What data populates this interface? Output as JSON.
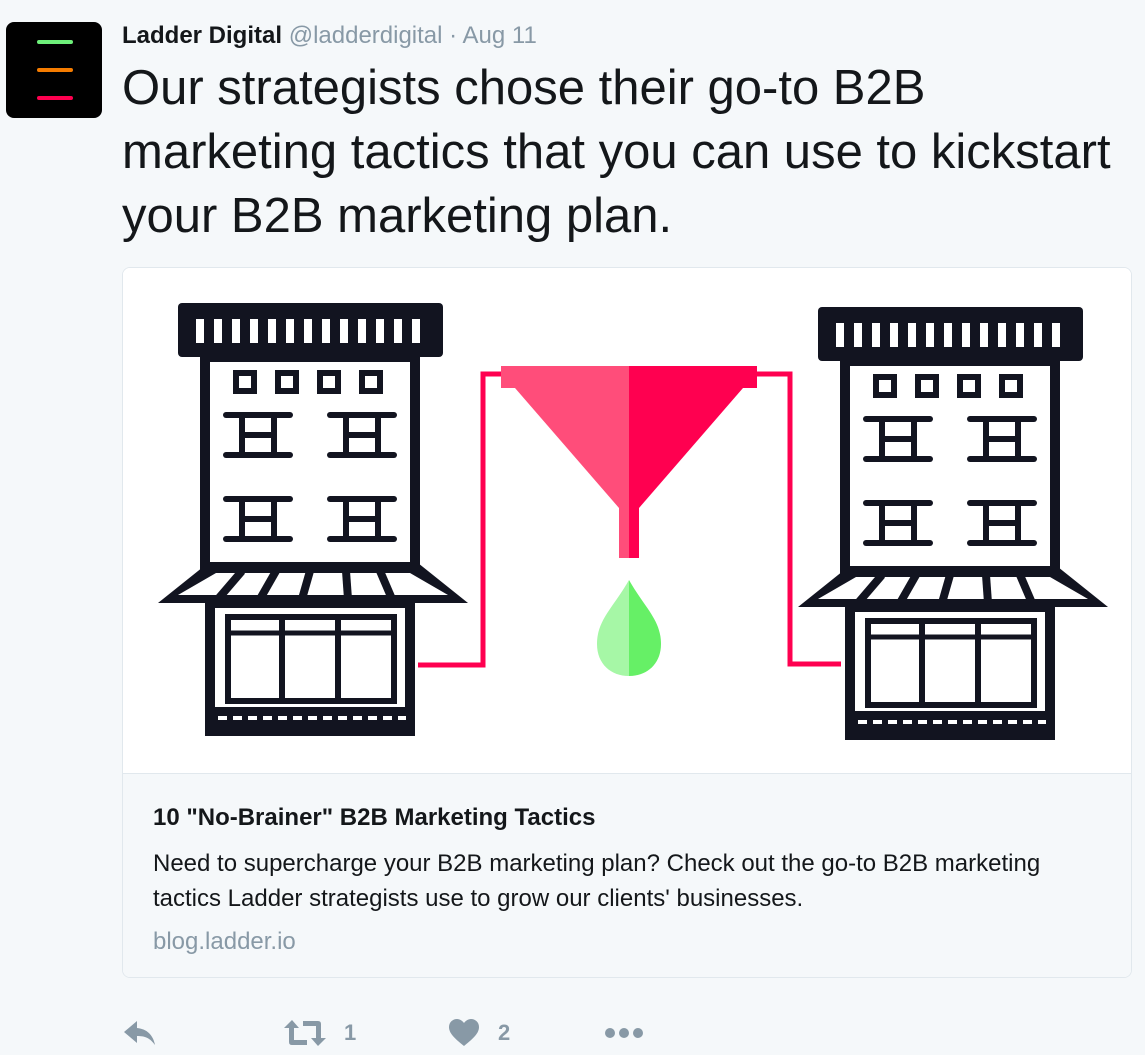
{
  "tweet": {
    "author_name": "Ladder Digital",
    "handle": "@ladderdigital",
    "separator": "·",
    "date": "Aug 11",
    "text": "Our strategists chose their go-to B2B marketing tactics that you can use to kickstart your B2B marketing plan."
  },
  "avatar": {
    "icon": "ladder-logo-icon",
    "colors": [
      "#6ef07a",
      "#f57c00",
      "#ff0050"
    ]
  },
  "card": {
    "image_icon": "storefront-funnel-illustration",
    "title": "10 \"No-Brainer\" B2B Marketing Tactics",
    "description": "Need to supercharge your B2B marketing plan? Check out the go-to B2B marketing tactics Ladder strategists use to grow our clients' businesses.",
    "domain": "blog.ladder.io"
  },
  "actions": {
    "reply_icon": "reply-icon",
    "retweet_icon": "retweet-icon",
    "retweet_count": "1",
    "like_icon": "heart-icon",
    "like_count": "2",
    "more_icon": "more-icon"
  },
  "colors": {
    "text": "#14171a",
    "muted": "#8899a6",
    "background": "#f5f8fa",
    "building": "#121420",
    "funnel_light": "#ff4d7a",
    "funnel_dark": "#ff0050",
    "drop_light": "#a6f7a6",
    "drop_dark": "#66f066"
  }
}
